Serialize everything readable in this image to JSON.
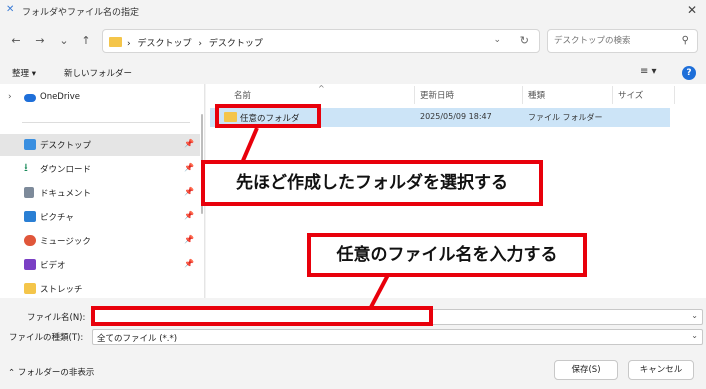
{
  "window": {
    "title": "フォルダやファイル名の指定",
    "close": "✕"
  },
  "nav": {
    "back": "←",
    "forward": "→",
    "recent": "⌄",
    "up": "↑",
    "breadcrumb": [
      "›",
      "デスクトップ",
      "›",
      "デスクトップ"
    ],
    "refresh": "↻",
    "search_placeholder": "デスクトップの検索"
  },
  "toolbar": {
    "organize": "整理 ▾",
    "new_folder": "新しいフォルダー",
    "view": "≡ ▾",
    "help": "?"
  },
  "sidebar": {
    "items": [
      {
        "label": "OneDrive",
        "chevron": "›",
        "pinned": false
      },
      {
        "label": "デスクトップ",
        "pinned": true,
        "selected": true
      },
      {
        "label": "ダウンロード",
        "pinned": true
      },
      {
        "label": "ドキュメント",
        "pinned": true
      },
      {
        "label": "ピクチャ",
        "pinned": true
      },
      {
        "label": "ミュージック",
        "pinned": true
      },
      {
        "label": "ビデオ",
        "pinned": true
      },
      {
        "label": "ストレッチ",
        "pinned": false
      }
    ],
    "pin_glyph": "📌"
  },
  "file_list": {
    "columns": [
      "名前",
      "更新日時",
      "種類",
      "サイズ"
    ],
    "sort_indicator": "^",
    "rows": [
      {
        "name": "任意のフォルダ",
        "modified": "2025/05/09 18:47",
        "type": "ファイル フォルダー",
        "size": ""
      }
    ]
  },
  "form": {
    "filename_label": "ファイル名(N):",
    "filename_value": "",
    "filetype_label": "ファイルの種類(T):",
    "filetype_value": "全てのファイル (*.*)"
  },
  "footer": {
    "hide_folders": "フォルダーの非表示",
    "save": "保存(S)",
    "cancel": "キャンセル"
  },
  "annotations": {
    "select_folder": "先ほど作成したフォルダを選択する",
    "enter_filename": "任意のファイル名を入力する",
    "color": "#e8000b"
  },
  "colors": {
    "accent": "#1e6fd9",
    "folder": "#f4c54a",
    "selection": "#cce4f7",
    "annotation": "#e8000b"
  }
}
